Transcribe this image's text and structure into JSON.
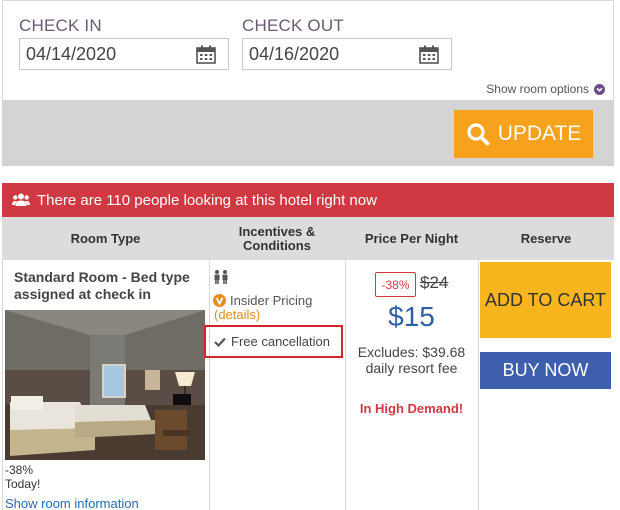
{
  "search": {
    "check_in_label": "CHECK IN",
    "check_in_value": "04/14/2020",
    "check_out_label": "CHECK OUT",
    "check_out_value": "04/16/2020",
    "show_room_options": "Show room options",
    "update_label": "UPDATE"
  },
  "alert": {
    "text": "There are 110 people looking at this hotel right now",
    "icon": "users-icon"
  },
  "table": {
    "headers": [
      "Room Type",
      "Incentives & Conditions",
      "Price Per Night",
      "Reserve"
    ],
    "room": {
      "name": "Standard Room - Bed type assigned at check in",
      "discount_line1": "-38%",
      "discount_line2": "Today!",
      "info_link": "Show room information"
    },
    "incentives": {
      "insider_label": "Insider Pricing",
      "details_link": "(details)",
      "free_cancellation": "Free cancellation"
    },
    "price": {
      "discount_badge": "-38%",
      "old_price": "$24",
      "new_price": "$15",
      "excludes": "Excludes: $39.68 daily resort fee",
      "demand": "In High Demand!"
    },
    "reserve": {
      "add_to_cart": "ADD TO CART",
      "buy_now": "BUY NOW"
    }
  },
  "colors": {
    "accent_orange": "#f6a21c",
    "alert_red": "#d03942",
    "cart_yellow": "#f8b51d",
    "buy_blue": "#3d5fae",
    "price_blue": "#2f5fa5",
    "label_purple": "#6c5a73"
  }
}
